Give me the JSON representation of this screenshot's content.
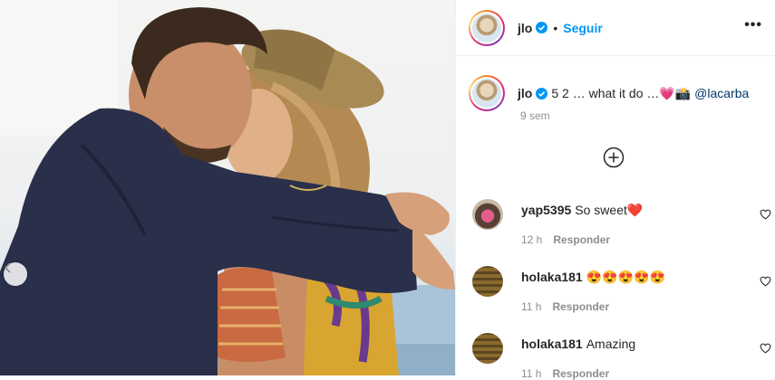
{
  "header": {
    "username": "jlo",
    "separator": "•",
    "follow_label": "Seguir",
    "more_label": "•••",
    "icons": {
      "avatar": "profile-avatar",
      "verified": "verified-badge-icon",
      "more": "more-options-icon"
    }
  },
  "caption": {
    "username": "jlo",
    "text": "5 2 … what it do …",
    "emoji": "💗📸",
    "mention": "@lacarba",
    "time": "9 sem"
  },
  "load_more": {
    "icon": "plus-circle-icon"
  },
  "comments": [
    {
      "username": "yap5395",
      "text": "So sweet❤️",
      "time": "12 h",
      "reply_label": "Responder"
    },
    {
      "username": "holaka181",
      "text": "😍😍😍😍😍",
      "time": "11 h",
      "reply_label": "Responder"
    },
    {
      "username": "holaka181",
      "text": "Amazing",
      "time": "11 h",
      "reply_label": "Responder"
    }
  ],
  "colors": {
    "accent": "#0095f6",
    "muted": "#8e8e8e",
    "mention": "#00376b",
    "text": "#262626"
  }
}
